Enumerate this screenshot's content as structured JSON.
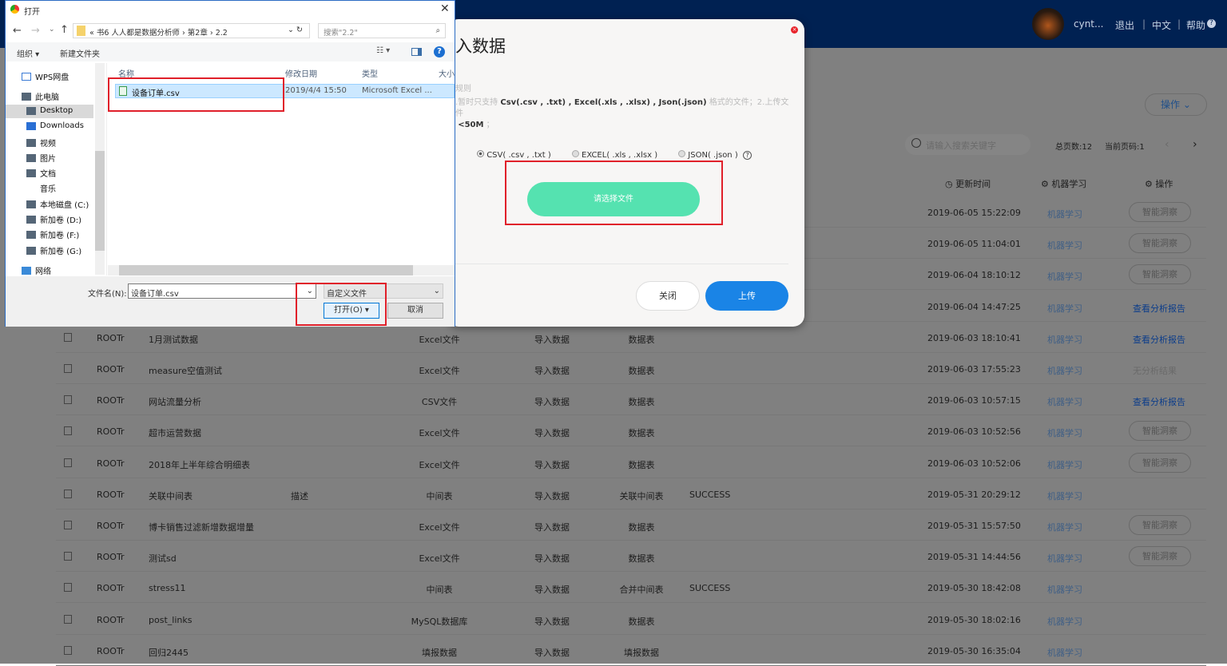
{
  "header": {
    "user": "cynt...",
    "logout": "退出",
    "lang": "中文",
    "help": "帮助"
  },
  "toolbar": {
    "action_btn": "操作",
    "search_placeholder": "请输入搜索关键字",
    "total_pages": "总页数:12",
    "current_page": "当前页码:1"
  },
  "columns": {
    "time": "更新时间",
    "ml": "机器学习",
    "action": "操作"
  },
  "rows": [
    {
      "owner": "",
      "name": "",
      "desc": "",
      "type": "",
      "source": "",
      "kind": "",
      "status": "",
      "time": "2019-06-05 15:22:09",
      "ml": "机器学习",
      "action": "智能洞察",
      "action_style": "btn"
    },
    {
      "owner": "",
      "name": "",
      "desc": "",
      "type": "",
      "source": "",
      "kind": "",
      "status": "",
      "time": "2019-06-05 11:04:01",
      "ml": "机器学习",
      "action": "智能洞察",
      "action_style": "btn"
    },
    {
      "owner": "",
      "name": "",
      "desc": "",
      "type": "",
      "source": "",
      "kind": "",
      "status": "",
      "time": "2019-06-04 18:10:12",
      "ml": "机器学习",
      "action": "智能洞察",
      "action_style": "btn"
    },
    {
      "owner": "",
      "name": "",
      "desc": "",
      "type": "",
      "source": "",
      "kind": "",
      "status": "",
      "time": "2019-06-04 14:47:25",
      "ml": "机器学习",
      "action": "查看分析报告",
      "action_style": "link"
    },
    {
      "owner": "ROOTr",
      "name": "1月测试数据",
      "desc": "",
      "type": "Excel文件",
      "source": "导入数据",
      "kind": "数据表",
      "status": "",
      "time": "2019-06-03 18:10:41",
      "ml": "机器学习",
      "action": "查看分析报告",
      "action_style": "link"
    },
    {
      "owner": "ROOTr",
      "name": "measure空值测试",
      "desc": "",
      "type": "Excel文件",
      "source": "导入数据",
      "kind": "数据表",
      "status": "",
      "time": "2019-06-03 17:55:23",
      "ml": "机器学习",
      "action": "无分析结果",
      "action_style": "none"
    },
    {
      "owner": "ROOTr",
      "name": "网站流量分析",
      "desc": "",
      "type": "CSV文件",
      "source": "导入数据",
      "kind": "数据表",
      "status": "",
      "time": "2019-06-03 10:57:15",
      "ml": "机器学习",
      "action": "查看分析报告",
      "action_style": "link"
    },
    {
      "owner": "ROOTr",
      "name": "超市运营数据",
      "desc": "",
      "type": "Excel文件",
      "source": "导入数据",
      "kind": "数据表",
      "status": "",
      "time": "2019-06-03 10:52:56",
      "ml": "机器学习",
      "action": "智能洞察",
      "action_style": "btn"
    },
    {
      "owner": "ROOTr",
      "name": "2018年上半年综合明细表",
      "desc": "",
      "type": "Excel文件",
      "source": "导入数据",
      "kind": "数据表",
      "status": "",
      "time": "2019-06-03 10:52:06",
      "ml": "机器学习",
      "action": "智能洞察",
      "action_style": "btn"
    },
    {
      "owner": "ROOTr",
      "name": "关联中间表",
      "desc": "描述",
      "type": "中间表",
      "source": "导入数据",
      "kind": "关联中间表",
      "status": "SUCCESS",
      "time": "2019-05-31 20:29:12",
      "ml": "机器学习",
      "action": "",
      "action_style": "none"
    },
    {
      "owner": "ROOTr",
      "name": "博卡销售过滤新增数据增量",
      "desc": "",
      "type": "Excel文件",
      "source": "导入数据",
      "kind": "数据表",
      "status": "",
      "time": "2019-05-31 15:57:50",
      "ml": "机器学习",
      "action": "智能洞察",
      "action_style": "btn"
    },
    {
      "owner": "ROOTr",
      "name": "测试sd",
      "desc": "",
      "type": "Excel文件",
      "source": "导入数据",
      "kind": "数据表",
      "status": "",
      "time": "2019-05-31 14:44:56",
      "ml": "机器学习",
      "action": "智能洞察",
      "action_style": "btn"
    },
    {
      "owner": "ROOTr",
      "name": "stress11",
      "desc": "",
      "type": "中间表",
      "source": "导入数据",
      "kind": "合并中间表",
      "status": "SUCCESS",
      "time": "2019-05-30 18:42:08",
      "ml": "机器学习",
      "action": "",
      "action_style": "none"
    },
    {
      "owner": "ROOTr",
      "name": "post_links",
      "desc": "",
      "type": "MySQL数据库",
      "source": "导入数据",
      "kind": "数据表",
      "status": "",
      "time": "2019-05-30 18:02:16",
      "ml": "机器学习",
      "action": "",
      "action_style": "none"
    },
    {
      "owner": "ROOTr",
      "name": "回归2445",
      "desc": "",
      "type": "填报数据",
      "source": "导入数据",
      "kind": "填报数据",
      "status": "",
      "time": "2019-05-30 16:35:04",
      "ml": "机器学习",
      "action": "",
      "action_style": "none"
    }
  ],
  "modal": {
    "title": "入数据",
    "rules_label": "规则",
    "rule_prefix": ".暂时只支持",
    "rule_formats": "Csv(.csv , .txt) , Excel(.xls , .xlsx) , Json(.json)",
    "rule_suffix": "格式的文件；2.上传文件",
    "rule_size": "<50M",
    "rule_end": "；",
    "options": [
      "CSV( .csv , .txt )",
      "EXCEL( .xls , .xlsx )",
      "JSON( .json )"
    ],
    "selected": 0,
    "choose_file": "请选择文件",
    "close": "关闭",
    "upload": "上传",
    "accent": "#55e2b0",
    "primary": "#1a84e6"
  },
  "dialog": {
    "title": "打开",
    "path": [
      "«",
      "书6 人人都是数据分析师",
      "›",
      "第2章",
      "›",
      "2.2"
    ],
    "search_placeholder": "搜索\"2.2\"",
    "organize": "组织 ▾",
    "new_folder": "新建文件夹",
    "nav": [
      "WPS网盘",
      "此电脑",
      "Desktop",
      "Downloads",
      "视频",
      "图片",
      "文档",
      "音乐",
      "本地磁盘 (C:)",
      "新加卷 (D:)",
      "新加卷 (F:)",
      "新加卷 (G:)",
      "网络"
    ],
    "nav_selected": "Desktop",
    "cols": [
      "名称",
      "修改日期",
      "类型",
      "大小"
    ],
    "file": {
      "name": "设备订单.csv",
      "date": "2019/4/4 15:50",
      "type": "Microsoft Excel ..."
    },
    "filename_label": "文件名(N):",
    "filename": "设备订单.csv",
    "filter": "自定义文件",
    "open": "打开(O)",
    "cancel": "取消"
  }
}
